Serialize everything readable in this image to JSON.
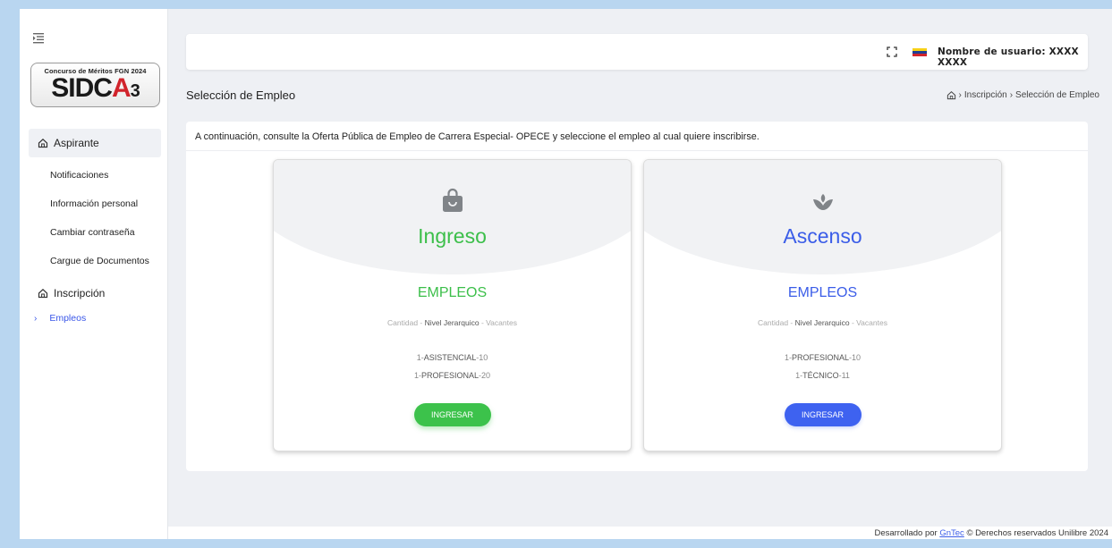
{
  "sidebar": {
    "logo_top": "Concurso de Méritos FGN 2024",
    "logo_main_a": "SIDC",
    "logo_main_b": "A",
    "logo_main_c": "3",
    "groups": [
      {
        "label": "Aspirante",
        "icon": "home-icon"
      },
      {
        "label": "Inscripción",
        "icon": "home-icon"
      }
    ],
    "items": [
      "Notificaciones",
      "Información personal",
      "Cambiar contraseña",
      "Cargue de Documentos"
    ],
    "sub_item": "Empleos",
    "sub_chevron": "›"
  },
  "header": {
    "username": "Nombre de usuario: XXXX XXXX",
    "flag_colors": [
      "#f7d117",
      "#1f3f94",
      "#d1242c"
    ]
  },
  "page": {
    "title": "Selección de Empleo",
    "breadcrumb": [
      "Inscripción",
      "Selección de Empleo"
    ],
    "breadcrumb_sep": "›",
    "intro": "A continuación, consulte la Oferta Pública de Empleo de Carrera Especial- OPECE y seleccione el empleo al cual quiere inscribirse."
  },
  "cards": [
    {
      "title": "Ingreso",
      "icon": "shopping-bag-icon",
      "empleos": "EMPLEOS",
      "legend_a": "Cantidad -",
      "legend_b": "Nivel Jerarquico",
      "legend_c": "- Vacantes",
      "rows": [
        {
          "q": "1-",
          "k": "ASISTENCIAL",
          "v": "-10"
        },
        {
          "q": "1-",
          "k": "PROFESIONAL",
          "v": "-20"
        }
      ],
      "button": "INGRESAR",
      "accent": "#3cbf4a"
    },
    {
      "title": "Ascenso",
      "icon": "sprout-icon",
      "empleos": "EMPLEOS",
      "legend_a": "Cantidad -",
      "legend_b": "Nivel Jerarquico",
      "legend_c": "- Vacantes",
      "rows": [
        {
          "q": "1-",
          "k": "PROFESIONAL",
          "v": "-10"
        },
        {
          "q": "1-",
          "k": "TÉCNICO",
          "v": "-11"
        }
      ],
      "button": "INGRESAR",
      "accent": "#3b5de8"
    }
  ],
  "footer": {
    "prefix": "Desarrollado por",
    "link": "GnTec",
    "suffix": "© Derechos reservados Unilibre 2024"
  }
}
